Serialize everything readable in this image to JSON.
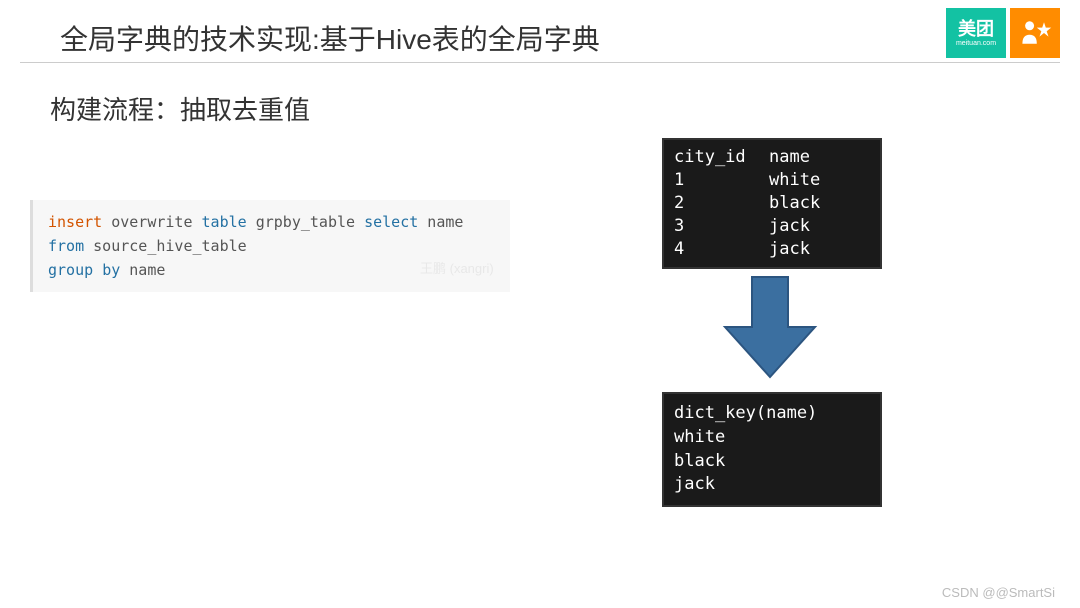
{
  "title": "全局字典的技术实现:基于Hive表的全局字典",
  "subtitle": "构建流程：抽取去重值",
  "logo": {
    "meituan_text": "美团",
    "meituan_sub": "meituan.com"
  },
  "code": {
    "line1": {
      "k1": "insert",
      "t1": " overwrite ",
      "k2": "table",
      "t2": " grpby_table ",
      "k3": "select",
      "t3": " name"
    },
    "line2": {
      "t1": "  ",
      "k1": "from",
      "t2": " source_hive_table"
    },
    "line3": {
      "t1": " ",
      "k1": "group",
      "t2": " ",
      "k2": "by",
      "t3": " name"
    }
  },
  "watermark_inline": "王鹏 (xangri)",
  "table_top": {
    "header": {
      "col1": "city_id",
      "col2": "name"
    },
    "rows": [
      {
        "col1": "1",
        "col2": "white"
      },
      {
        "col1": "2",
        "col2": "black"
      },
      {
        "col1": "3",
        "col2": "jack"
      },
      {
        "col1": "4",
        "col2": "jack"
      }
    ]
  },
  "table_bottom": {
    "header": "dict_key(name)",
    "rows": [
      "white",
      "black",
      "jack"
    ]
  },
  "footer": "CSDN @@SmartSi"
}
